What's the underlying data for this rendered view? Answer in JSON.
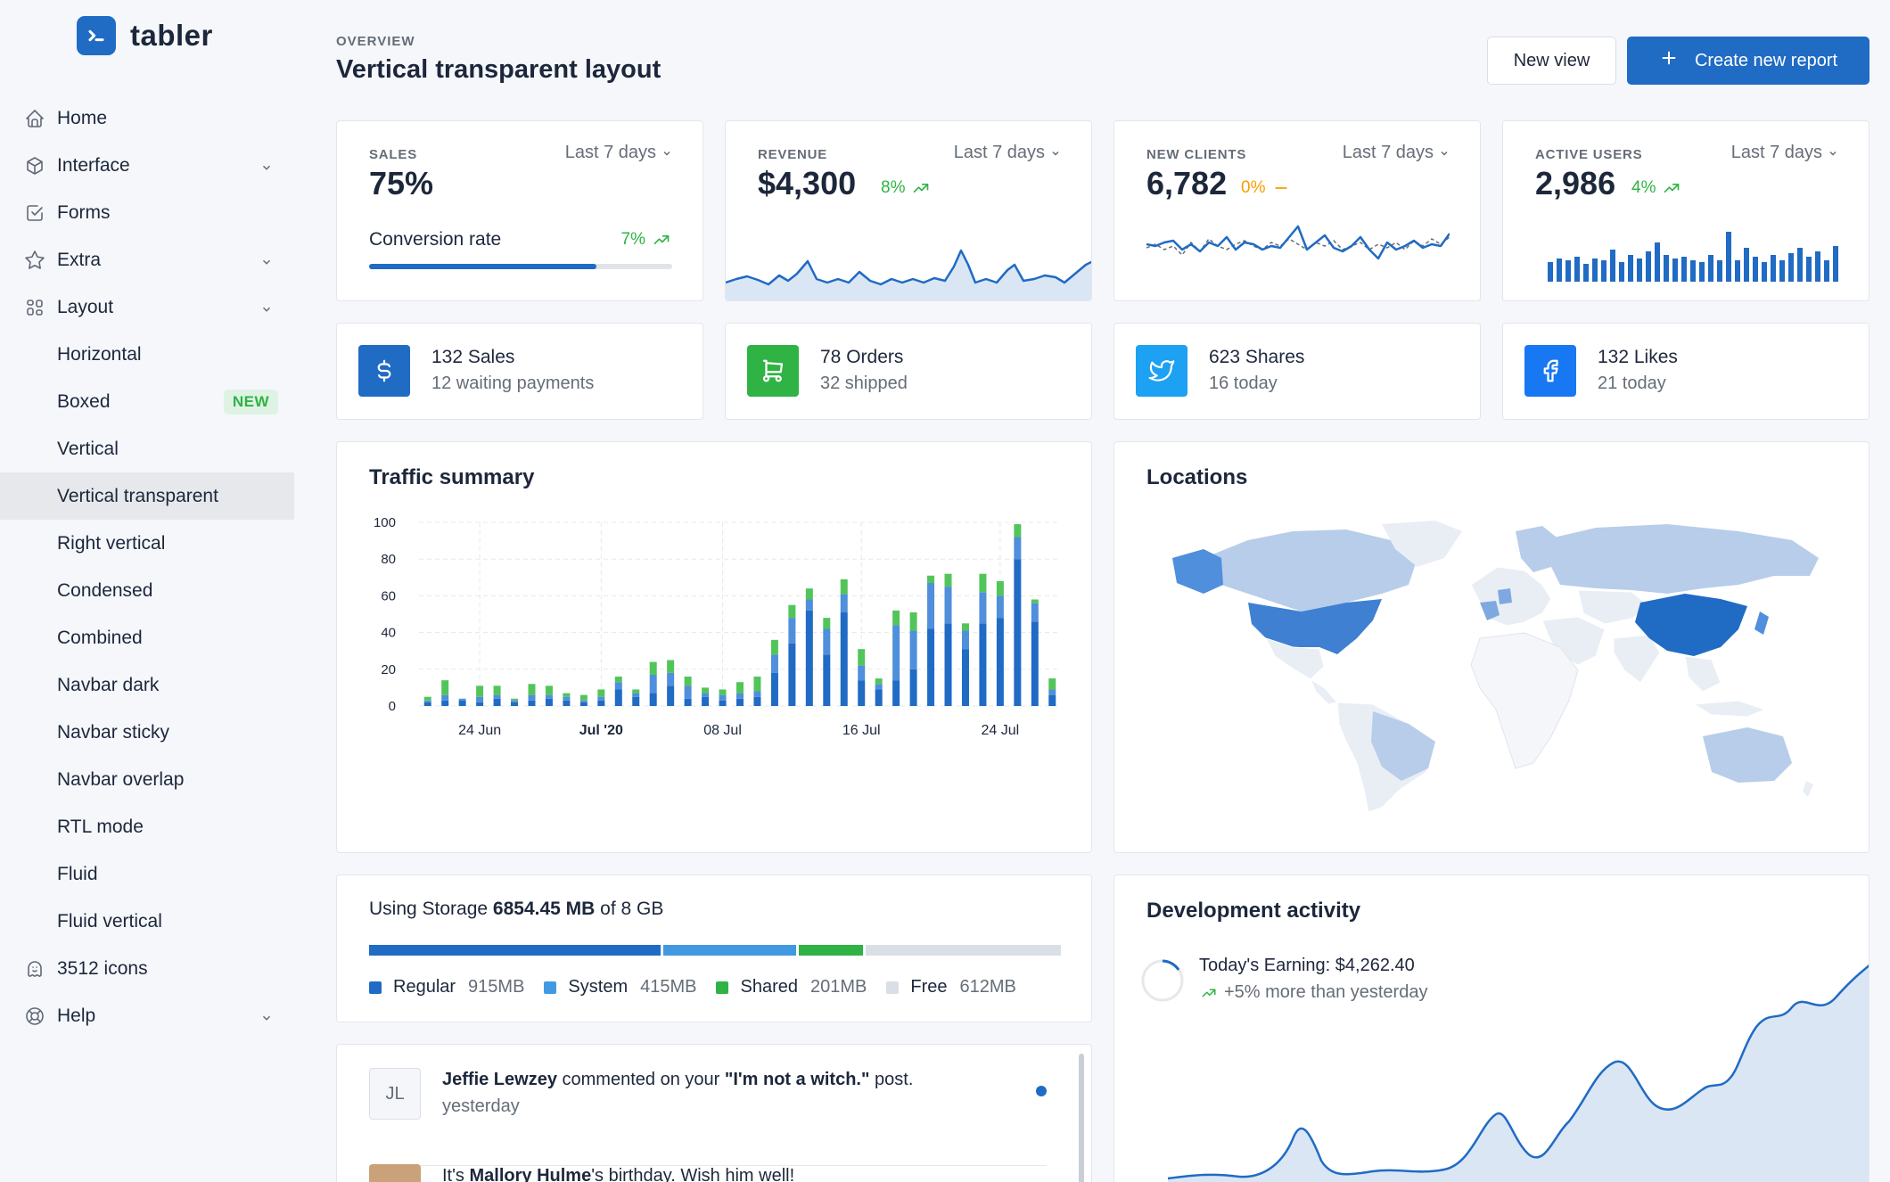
{
  "brand": {
    "name": "tabler"
  },
  "sidebar": {
    "items": [
      {
        "label": "Home"
      },
      {
        "label": "Interface"
      },
      {
        "label": "Forms"
      },
      {
        "label": "Extra"
      },
      {
        "label": "Layout"
      },
      {
        "label": "Horizontal"
      },
      {
        "label": "Boxed",
        "badge": "NEW"
      },
      {
        "label": "Vertical"
      },
      {
        "label": "Vertical transparent"
      },
      {
        "label": "Right vertical"
      },
      {
        "label": "Condensed"
      },
      {
        "label": "Combined"
      },
      {
        "label": "Navbar dark"
      },
      {
        "label": "Navbar sticky"
      },
      {
        "label": "Navbar overlap"
      },
      {
        "label": "RTL mode"
      },
      {
        "label": "Fluid"
      },
      {
        "label": "Fluid vertical"
      },
      {
        "label": "3512 icons"
      },
      {
        "label": "Help"
      }
    ]
  },
  "header": {
    "pretitle": "OVERVIEW",
    "title": "Vertical transparent layout",
    "new_view": "New view",
    "create_report": "Create new report"
  },
  "stats": [
    {
      "subheader": "SALES",
      "period": "Last 7 days",
      "value": "75%",
      "label": "Conversion rate",
      "delta": "7%",
      "progress": 0.75
    },
    {
      "subheader": "REVENUE",
      "period": "Last 7 days",
      "value": "$4,300",
      "delta": "8%"
    },
    {
      "subheader": "NEW CLIENTS",
      "period": "Last 7 days",
      "value": "6,782",
      "delta": "0%"
    },
    {
      "subheader": "ACTIVE USERS",
      "period": "Last 7 days",
      "value": "2,986",
      "delta": "4%"
    }
  ],
  "mini": [
    {
      "title": "132 Sales",
      "sub": "12 waiting payments",
      "color": "#206bc4",
      "icon": "dollar-icon"
    },
    {
      "title": "78 Orders",
      "sub": "32 shipped",
      "color": "#2fb344",
      "icon": "cart-icon"
    },
    {
      "title": "623 Shares",
      "sub": "16 today",
      "color": "#1da1f2",
      "icon": "twitter-icon"
    },
    {
      "title": "132 Likes",
      "sub": "21 today",
      "color": "#1877f2",
      "icon": "facebook-icon"
    }
  ],
  "traffic": {
    "title": "Traffic summary"
  },
  "chart_data": {
    "type": "bar",
    "stacked": true,
    "yticks": [
      "0",
      "20",
      "40",
      "60",
      "80",
      "100"
    ],
    "ylim": [
      0,
      100
    ],
    "xticks": [
      {
        "label": "24 Jun",
        "index": 3
      },
      {
        "label": "Jul '20",
        "index": 10
      },
      {
        "label": "08 Jul",
        "index": 17
      },
      {
        "label": "16 Jul",
        "index": 25
      },
      {
        "label": "24 Jul",
        "index": 33
      }
    ],
    "series": [
      {
        "color": "#206bc4",
        "values": [
          2,
          3,
          3,
          2,
          4,
          2,
          3,
          4,
          3,
          2,
          3,
          9,
          5,
          7,
          11,
          4,
          5,
          3,
          4,
          5,
          18,
          34,
          52,
          28,
          51,
          14,
          9,
          14,
          20,
          42,
          45,
          31,
          45,
          48,
          80,
          46,
          6
        ]
      },
      {
        "color": "#4f8fdb",
        "values": [
          1,
          3,
          1,
          3,
          2,
          1,
          3,
          2,
          2,
          1,
          2,
          4,
          2,
          10,
          7,
          7,
          2,
          3,
          3,
          3,
          10,
          14,
          6,
          14,
          10,
          8,
          3,
          30,
          21,
          25,
          20,
          10,
          17,
          12,
          12,
          10,
          3
        ]
      },
      {
        "color": "#52c55a",
        "values": [
          2,
          8,
          0,
          6,
          5,
          1,
          6,
          5,
          2,
          3,
          4,
          3,
          2,
          7,
          7,
          5,
          3,
          3,
          6,
          8,
          8,
          7,
          6,
          6,
          8,
          9,
          3,
          8,
          10,
          4,
          7,
          4,
          10,
          8,
          7,
          2,
          6
        ]
      }
    ]
  },
  "locations": {
    "title": "Locations"
  },
  "storage": {
    "prefix": "Using Storage",
    "used": "6854.45 MB",
    "suffix": "of 8 GB",
    "segments": [
      {
        "name": "Regular",
        "value": "915MB",
        "mb": 915,
        "color": "#206bc4"
      },
      {
        "name": "System",
        "value": "415MB",
        "mb": 415,
        "color": "#4299e1"
      },
      {
        "name": "Shared",
        "value": "201MB",
        "mb": 201,
        "color": "#2fb344"
      },
      {
        "name": "Free",
        "value": "612MB",
        "mb": 612,
        "color": "#dadfe5"
      }
    ]
  },
  "activity": {
    "item1": {
      "initials": "JL",
      "name": "Jeffie Lewzey",
      "mid": "commented on your",
      "quote": "\"I'm not a witch.\"",
      "end": "post.",
      "time": "yesterday"
    },
    "item2": {
      "pre": "It's",
      "name": "Mallory Hulme",
      "end": "'s birthday. Wish him well!"
    }
  },
  "dev": {
    "title": "Development activity",
    "earning_label": "Today's Earning: $4,262.40",
    "trend": "+5% more than yesterday"
  },
  "colors": {
    "primary": "#206bc4",
    "green": "#2fb344",
    "yellow": "#f59f00"
  }
}
